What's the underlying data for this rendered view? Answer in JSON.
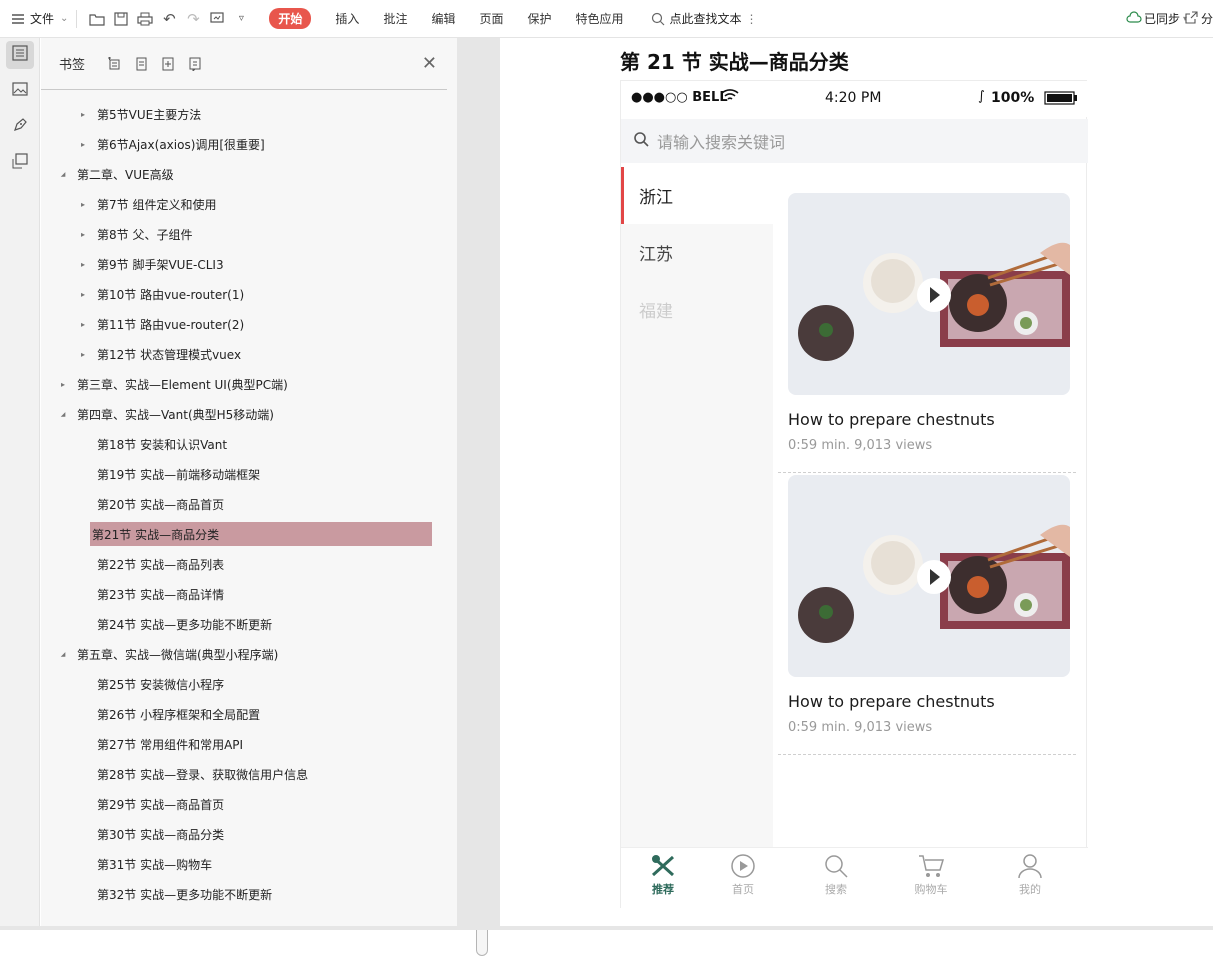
{
  "toolbar": {
    "file_menu": "文件",
    "tabs": [
      "开始",
      "插入",
      "批注",
      "编辑",
      "页面",
      "保护",
      "特色应用"
    ],
    "search_text": "点此查找文本",
    "sync_status": "已同步",
    "share_label": "分"
  },
  "bookmark_panel": {
    "title": "书签",
    "items": [
      {
        "label": "第5节VUE主要方法",
        "level": 2,
        "arrow": "collapsed"
      },
      {
        "label": "第6节Ajax(axios)调用[很重要]",
        "level": 2,
        "arrow": "collapsed"
      },
      {
        "label": "第二章、VUE高级",
        "level": 1,
        "arrow": "expanded"
      },
      {
        "label": "第7节 组件定义和使用",
        "level": 2,
        "arrow": "collapsed"
      },
      {
        "label": "第8节 父、子组件",
        "level": 2,
        "arrow": "collapsed"
      },
      {
        "label": "第9节 脚手架VUE-CLI3",
        "level": 2,
        "arrow": "collapsed"
      },
      {
        "label": "第10节 路由vue-router(1)",
        "level": 2,
        "arrow": "collapsed"
      },
      {
        "label": "第11节 路由vue-router(2)",
        "level": 2,
        "arrow": "collapsed"
      },
      {
        "label": "第12节 状态管理模式vuex",
        "level": 2,
        "arrow": "collapsed"
      },
      {
        "label": "第三章、实战—Element UI(典型PC端)",
        "level": 1,
        "arrow": "collapsed"
      },
      {
        "label": "第四章、实战—Vant(典型H5移动端)",
        "level": 1,
        "arrow": "expanded"
      },
      {
        "label": "第18节 安装和认识Vant",
        "level": 2,
        "arrow": "none"
      },
      {
        "label": "第19节 实战—前端移动端框架",
        "level": 2,
        "arrow": "none"
      },
      {
        "label": "第20节 实战—商品首页",
        "level": 2,
        "arrow": "none"
      },
      {
        "label": "第21节 实战—商品分类",
        "level": 2,
        "arrow": "none",
        "selected": true
      },
      {
        "label": "第22节 实战—商品列表",
        "level": 2,
        "arrow": "none"
      },
      {
        "label": "第23节 实战—商品详情",
        "level": 2,
        "arrow": "none"
      },
      {
        "label": "第24节 实战—更多功能不断更新",
        "level": 2,
        "arrow": "none"
      },
      {
        "label": "第五章、实战—微信端(典型小程序端)",
        "level": 1,
        "arrow": "expanded"
      },
      {
        "label": "第25节 安装微信小程序",
        "level": 2,
        "arrow": "none"
      },
      {
        "label": "第26节 小程序框架和全局配置",
        "level": 2,
        "arrow": "none"
      },
      {
        "label": "第27节 常用组件和常用API",
        "level": 2,
        "arrow": "none"
      },
      {
        "label": "第28节 实战—登录、获取微信用户信息",
        "level": 2,
        "arrow": "none"
      },
      {
        "label": "第29节 实战—商品首页",
        "level": 2,
        "arrow": "none"
      },
      {
        "label": "第30节 实战—商品分类",
        "level": 2,
        "arrow": "none"
      },
      {
        "label": "第31节 实战—购物车",
        "level": 2,
        "arrow": "none"
      },
      {
        "label": "第32节 实战—更多功能不断更新",
        "level": 2,
        "arrow": "none"
      }
    ]
  },
  "document": {
    "heading": "第 21 节  实战—商品分类",
    "phone": {
      "status": {
        "carrier": "●●●○○ BELL",
        "time": "4:20 PM",
        "battery": "100%"
      },
      "search_placeholder": "请输入搜索关键词",
      "categories": [
        "浙江",
        "江苏",
        "福建"
      ],
      "cards": [
        {
          "title": "How to prepare chestnuts",
          "meta": "0:59 min. 9,013 views"
        },
        {
          "title": "How to prepare chestnuts",
          "meta": "0:59 min. 9,013 views"
        }
      ],
      "tabbar": [
        "推荐",
        "首页",
        "搜索",
        "购物车",
        "我的"
      ]
    }
  },
  "colors": {
    "start_tab": "#e8564c",
    "selected_bookmark": "#c99aa0",
    "category_accent": "#e24646",
    "tab_active": "#2f6b5c"
  }
}
